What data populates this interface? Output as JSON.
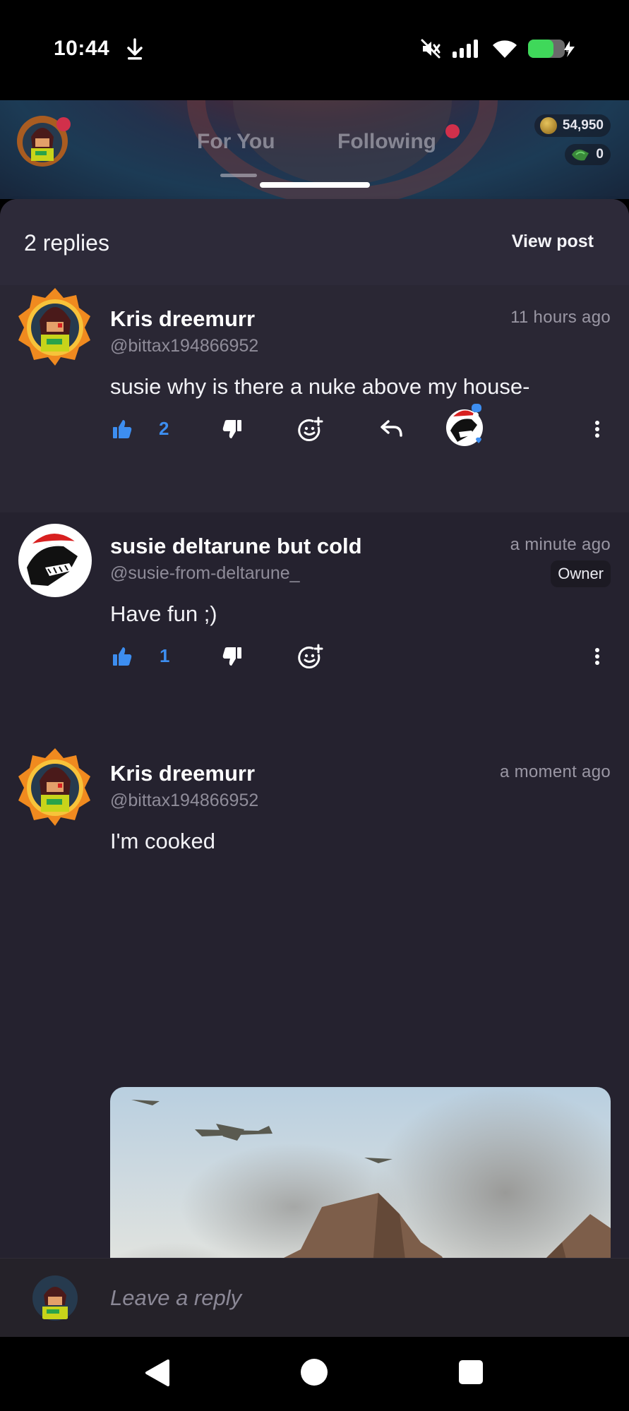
{
  "status_bar": {
    "time": "10:44"
  },
  "header": {
    "tabs": [
      {
        "label": "For You"
      },
      {
        "label": "Following"
      }
    ],
    "coins": "54,950",
    "gems": "0"
  },
  "sheet": {
    "replies_count": "2 replies",
    "view_post_label": "View post"
  },
  "comments": [
    {
      "name": "Kris dreemurr",
      "handle": "@bittax194866952",
      "time": "11 hours ago",
      "text": "susie why is there a nuke above my house-",
      "likes": "2"
    },
    {
      "name": "susie deltarune but cold",
      "handle": "@susie-from-deltarune_",
      "time": "a minute ago",
      "badge": "Owner",
      "text": "Have fun ;)",
      "likes": "1"
    },
    {
      "name": "Kris dreemurr",
      "handle": "@bittax194866952",
      "time": "a moment ago",
      "text": "I'm cooked"
    }
  ],
  "reply_bar": {
    "placeholder": "Leave a reply"
  },
  "colors": {
    "background": "#25222f",
    "accent_blue": "#3d8ef0",
    "badge_red": "#d1304b"
  },
  "icons": [
    "download-icon",
    "mute-icon",
    "signal-icon",
    "wifi-icon",
    "battery-icon",
    "thumbs-up-icon",
    "thumbs-down-icon",
    "add-reaction-icon",
    "reply-icon",
    "more-icon",
    "back-icon",
    "home-icon",
    "recents-icon"
  ]
}
